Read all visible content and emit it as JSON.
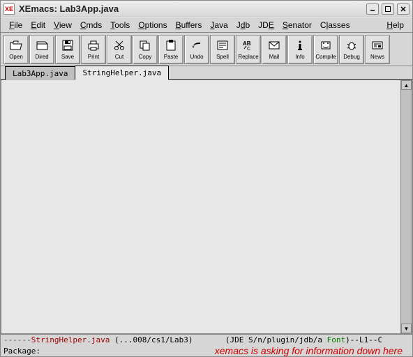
{
  "titlebar": {
    "app_icon_text": "XE",
    "title": "XEmacs: Lab3App.java"
  },
  "menus": {
    "file": "File",
    "edit": "Edit",
    "view": "View",
    "cmds": "Cmds",
    "tools": "Tools",
    "options": "Options",
    "buffers": "Buffers",
    "java": "Java",
    "jdb": "Jdb",
    "jde": "JDE",
    "senator": "Senator",
    "classes": "Classes",
    "help": "Help"
  },
  "toolbar": {
    "open": "Open",
    "dired": "Dired",
    "save": "Save",
    "print": "Print",
    "cut": "Cut",
    "copy": "Copy",
    "paste": "Paste",
    "undo": "Undo",
    "spell": "Spell",
    "replace": "Replace",
    "mail": "Mail",
    "info": "Info",
    "compile": "Compile",
    "debug": "Debug",
    "news": "News"
  },
  "tabs": {
    "tab1": "Lab3App.java",
    "tab2": "StringHelper.java"
  },
  "modeline": {
    "prefix": "------",
    "filename": "StringHelper.java",
    "path": " (...008/cs1/Lab3)",
    "mid": "       (JDE S/n/plugin/jdb/a ",
    "font": "Font",
    "suffix": ")--L1--C"
  },
  "minibuffer": {
    "prompt": "Package:"
  },
  "annotation": "xemacs is asking for information down here"
}
